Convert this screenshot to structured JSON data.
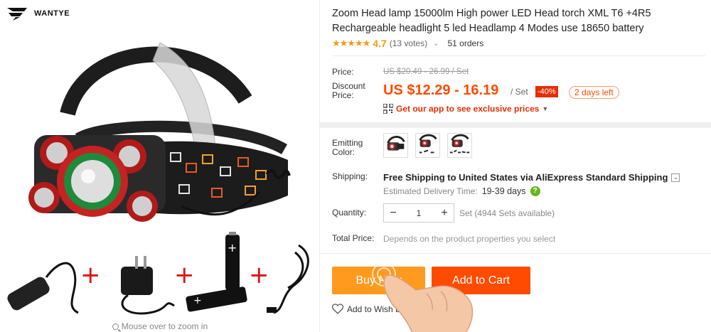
{
  "brand": {
    "name": "WANTYE"
  },
  "gallery": {
    "zoom_hint": "Mouse over to zoom in"
  },
  "product": {
    "title": "Zoom Head lamp 15000lm High power LED Head torch XML T6 +4R5 Rechargeable headlight 5 led Headlamp 4 Modes use 18650 battery",
    "rating": 4.7,
    "stars": "★★★★★",
    "votes_text": "(13 votes)",
    "orders_text": "51 orders"
  },
  "price": {
    "label": "Price:",
    "original": "US $20.49 - 26.99 / Set",
    "discount_label": "Discount Price:",
    "current": "US $12.29 - 16.19",
    "unit": "/ Set",
    "discount_badge": "-40%",
    "days_left": "2 days left",
    "app_promo": "Get our app to see exclusive prices"
  },
  "options": {
    "color_label": "Emitting Color:",
    "color_count": 3
  },
  "shipping": {
    "label": "Shipping:",
    "line": "Free Shipping to United States via AliExpress Standard Shipping",
    "est_label": "Estimated Delivery Time:",
    "est_days": "19-39 days",
    "help": "?"
  },
  "quantity": {
    "label": "Quantity:",
    "minus": "−",
    "value": "1",
    "plus": "+",
    "available": "Set (4944 Sets available)"
  },
  "total": {
    "label": "Total Price:",
    "note": "Depends on the product properties you select"
  },
  "actions": {
    "buy_now": "Buy Now",
    "add_to_cart": "Add to Cart",
    "wish_list": "Add to Wish List"
  },
  "colors": {
    "accent_orange": "#ff4b00",
    "buy_orange": "#ff9a1e",
    "star": "#f49a12",
    "badge_red": "#e62e04"
  },
  "icons": [
    "brand-logo",
    "magnifier-icon",
    "chevron-down-icon",
    "qr-code-icon",
    "caret-down-icon",
    "help-icon",
    "heart-icon"
  ]
}
